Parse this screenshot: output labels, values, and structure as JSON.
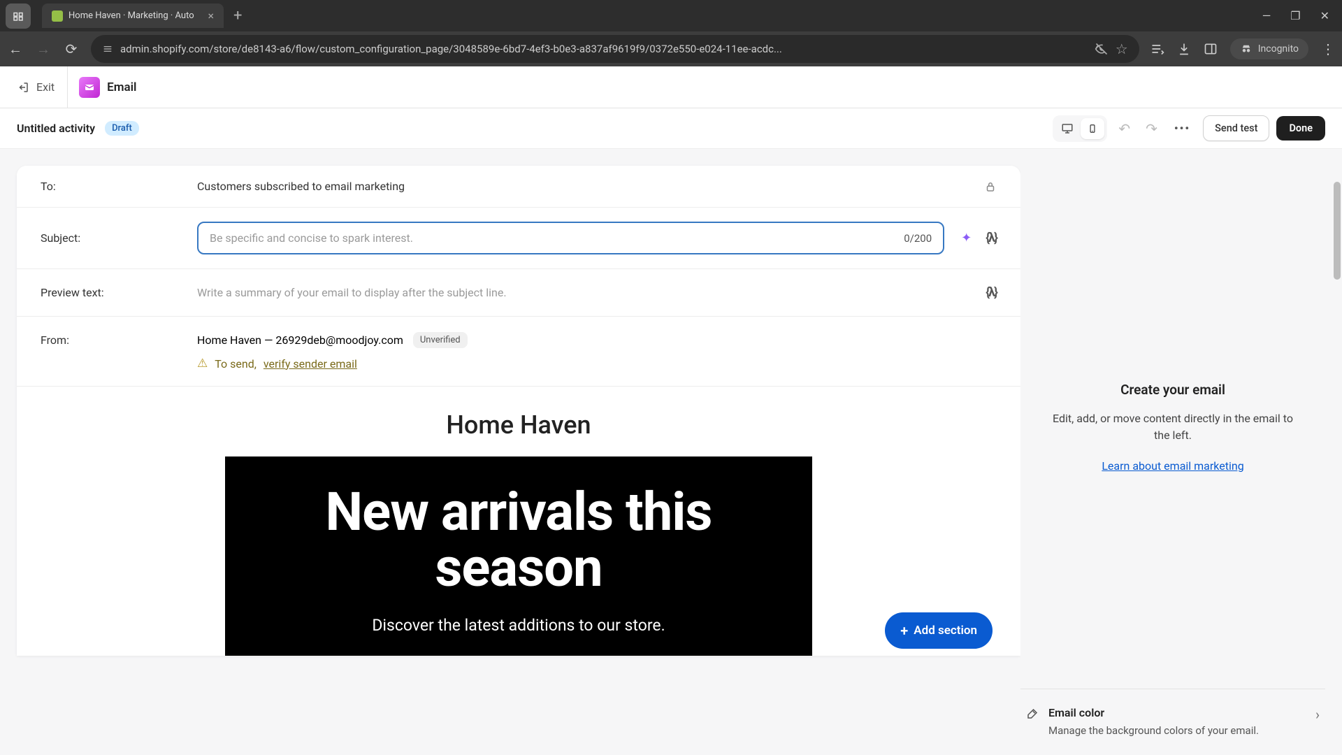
{
  "browser": {
    "tab_title": "Home Haven · Marketing · Auto",
    "url": "admin.shopify.com/store/de8143-a6/flow/custom_configuration_page/3048589e-6bd7-4ef3-b0e3-a837af9619f9/0372e550-e024-11ee-acdc...",
    "incognito_label": "Incognito"
  },
  "topbar": {
    "exit_label": "Exit",
    "app_label": "Email"
  },
  "activity": {
    "title": "Untitled activity",
    "status_badge": "Draft",
    "send_test_label": "Send test",
    "done_label": "Done"
  },
  "fields": {
    "to_label": "To:",
    "to_value": "Customers subscribed to email marketing",
    "subject_label": "Subject:",
    "subject_placeholder": "Be specific and concise to spark interest.",
    "subject_count": "0/200",
    "preview_label": "Preview text:",
    "preview_placeholder": "Write a summary of your email to display after the subject line.",
    "from_label": "From:",
    "from_value": "Home Haven — 26929deb@moodjoy.com",
    "unverified_badge": "Unverified",
    "verify_prefix": "To send, ",
    "verify_link": "verify sender email"
  },
  "canvas": {
    "brand": "Home Haven",
    "hero_headline": "New arrivals this season",
    "hero_sub": "Discover the latest additions to our store.",
    "add_section_label": "Add section"
  },
  "sidebar": {
    "title": "Create your email",
    "desc": "Edit, add, or move content directly in the email to the left.",
    "link": "Learn about email marketing",
    "color_title": "Email color",
    "color_desc": "Manage the background colors of your email."
  }
}
